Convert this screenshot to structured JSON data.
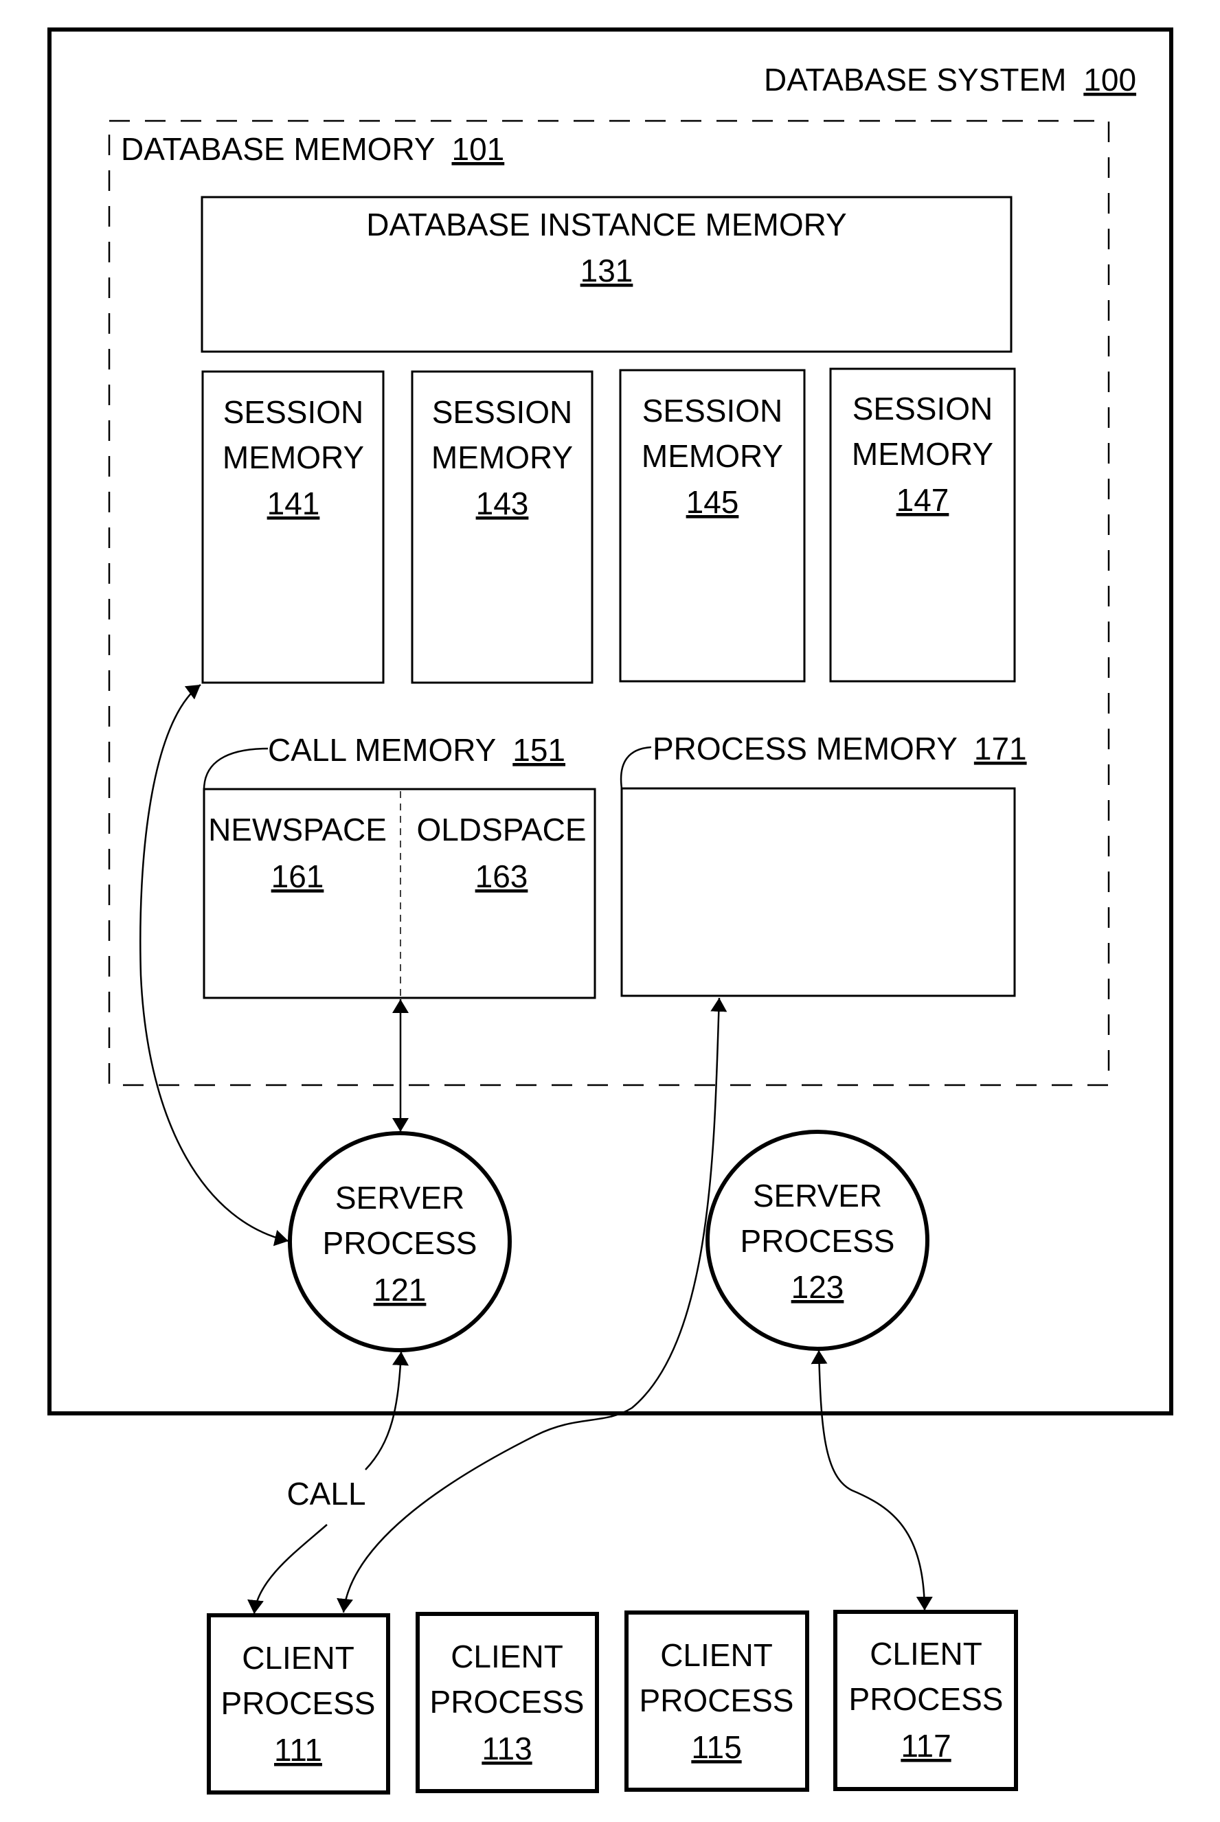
{
  "diagram": {
    "database_system": {
      "label": "DATABASE SYSTEM",
      "ref": "100"
    },
    "database_memory": {
      "label": "DATABASE MEMORY",
      "ref": "101"
    },
    "instance_memory": {
      "label": "DATABASE INSTANCE MEMORY",
      "ref": "131"
    },
    "session_memories": [
      {
        "line1": "SESSION",
        "line2": "MEMORY",
        "ref": "141"
      },
      {
        "line1": "SESSION",
        "line2": "MEMORY",
        "ref": "143"
      },
      {
        "line1": "SESSION",
        "line2": "MEMORY",
        "ref": "145"
      },
      {
        "line1": "SESSION",
        "line2": "MEMORY",
        "ref": "147"
      }
    ],
    "call_memory": {
      "label": "CALL MEMORY",
      "ref": "151",
      "newspace": {
        "label": "NEWSPACE",
        "ref": "161"
      },
      "oldspace": {
        "label": "OLDSPACE",
        "ref": "163"
      }
    },
    "process_memory": {
      "label": "PROCESS MEMORY",
      "ref": "171"
    },
    "server_processes": [
      {
        "line1": "SERVER",
        "line2": "PROCESS",
        "ref": "121"
      },
      {
        "line1": "SERVER",
        "line2": "PROCESS",
        "ref": "123"
      }
    ],
    "client_processes": [
      {
        "line1": "CLIENT",
        "line2": "PROCESS",
        "ref": "111"
      },
      {
        "line1": "CLIENT",
        "line2": "PROCESS",
        "ref": "113"
      },
      {
        "line1": "CLIENT",
        "line2": "PROCESS",
        "ref": "115"
      },
      {
        "line1": "CLIENT",
        "line2": "PROCESS",
        "ref": "117"
      }
    ],
    "call_label": "CALL"
  }
}
